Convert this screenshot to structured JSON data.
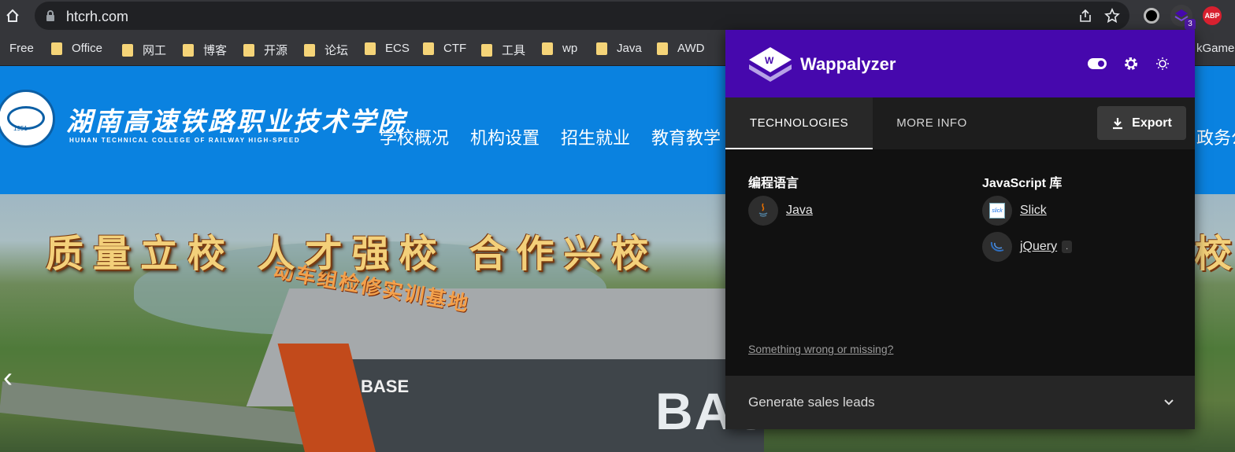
{
  "browser": {
    "url": "htcrh.com",
    "extensions": {
      "wappalyzer_badge": "3",
      "abp_label": "ABP"
    }
  },
  "bookmarks": {
    "items": [
      {
        "label": "Free"
      },
      {
        "label": "Office"
      },
      {
        "label": "网工"
      },
      {
        "label": "博客"
      },
      {
        "label": "开源"
      },
      {
        "label": "论坛"
      },
      {
        "label": "ECS"
      },
      {
        "label": "CTF"
      },
      {
        "label": "工具"
      },
      {
        "label": "wp"
      },
      {
        "label": "Java"
      },
      {
        "label": "AWD"
      }
    ],
    "overflow_visible": "kGame"
  },
  "site": {
    "school_name_cn": "湖南高速铁路职业技术学院",
    "school_name_en": "HUNAN TECHNICAL COLLEGE OF RAILWAY HIGH-SPEED",
    "logo_year": "1951",
    "nav": [
      "学校概况",
      "机构设置",
      "招生就业",
      "教育教学"
    ],
    "nav_right_partial": "政务公",
    "banner": {
      "slogan": "质量立校  人才强校  合作兴校",
      "slogan_right_partial": "校",
      "sign": "动车组检修实训基地",
      "base_large": "BAS",
      "base_small": "BASE",
      "prev_arrow": "‹"
    }
  },
  "wappalyzer": {
    "title": "Wappalyzer",
    "tabs": {
      "technologies": "TECHNOLOGIES",
      "more_info": "MORE INFO"
    },
    "export_label": "Export",
    "categories": [
      {
        "title": "编程语言",
        "techs": [
          {
            "name": "Java",
            "version": ""
          }
        ]
      },
      {
        "title": "JavaScript 库",
        "techs": [
          {
            "name": "Slick",
            "version": ""
          },
          {
            "name": "jQuery",
            "version": "."
          }
        ]
      }
    ],
    "wrong_link": "Something wrong or missing?",
    "leads_label": "Generate sales leads"
  },
  "colors": {
    "wappalyzer_purple": "#4608ad",
    "site_blue": "#0a82e0",
    "slogan_gold": "#f3d07a"
  }
}
